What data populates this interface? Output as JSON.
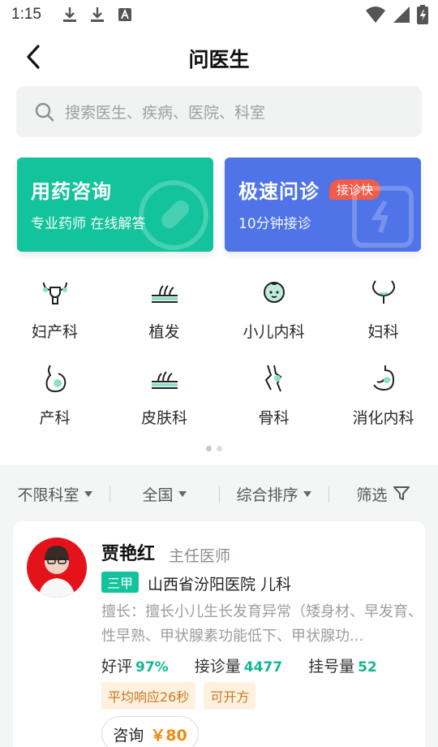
{
  "status_bar": {
    "time": "1:15"
  },
  "header": {
    "title": "问医生"
  },
  "search": {
    "placeholder": "搜索医生、疾病、医院、科室"
  },
  "service_cards": [
    {
      "title": "用药咨询",
      "subtitle": "专业药师  在线解答",
      "color": "#13c39c"
    },
    {
      "title": "极速问诊",
      "badge": "接诊快",
      "subtitle": "10分钟接诊",
      "color": "#4f74e8"
    }
  ],
  "categories": [
    {
      "label": "妇产科",
      "icon": "uterus-icon"
    },
    {
      "label": "植发",
      "icon": "hair-icon"
    },
    {
      "label": "小儿内科",
      "icon": "baby-icon"
    },
    {
      "label": "妇科",
      "icon": "ovary-icon"
    },
    {
      "label": "产科",
      "icon": "pregnancy-icon"
    },
    {
      "label": "皮肤科",
      "icon": "skin-icon"
    },
    {
      "label": "骨科",
      "icon": "bone-icon"
    },
    {
      "label": "消化内科",
      "icon": "stomach-icon"
    }
  ],
  "filters": [
    {
      "label": "不限科室"
    },
    {
      "label": "全国"
    },
    {
      "label": "综合排序"
    },
    {
      "label": "筛选"
    }
  ],
  "doctor": {
    "name": "贾艳红",
    "title": "主任医师",
    "grade": "三甲",
    "hospital": "山西省汾阳医院 儿科",
    "specialty": "擅长：擅长小儿生长发育异常（矮身材、早发育、性早熟、甲状腺素功能低下、甲状腺功...",
    "stats": [
      {
        "label": "好评",
        "value": "97%"
      },
      {
        "label": "接诊量",
        "value": "4477"
      },
      {
        "label": "挂号量",
        "value": "52"
      }
    ],
    "tags": [
      "平均响应26秒",
      "可开方"
    ],
    "consult_label": "咨询",
    "consult_price": "￥80"
  },
  "colors": {
    "accent": "#13c39c",
    "blue": "#4f74e8",
    "price": "#f08a12"
  }
}
